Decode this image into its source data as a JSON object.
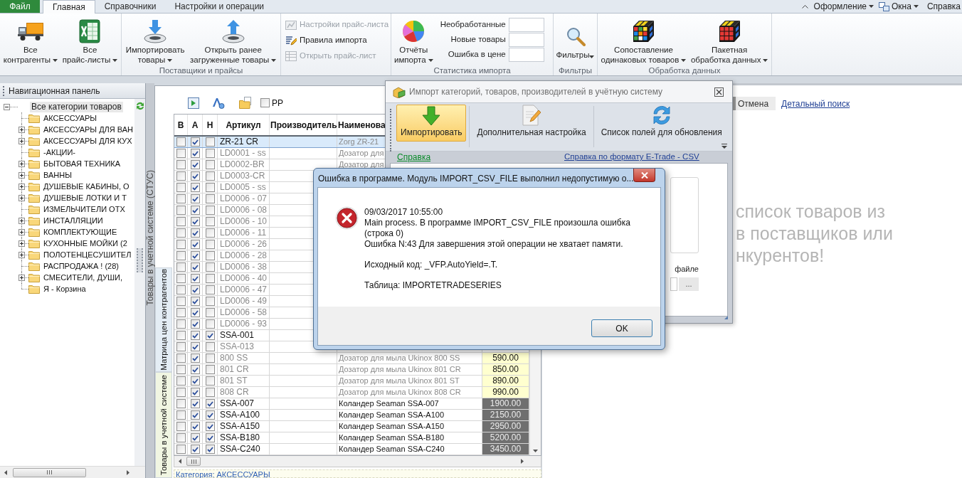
{
  "menu_bar": {
    "file_button": "Файл",
    "tabs": [
      {
        "label": "Главная",
        "selected": true
      },
      {
        "label": "Справочники",
        "selected": false
      },
      {
        "label": "Настройки и операции",
        "selected": false
      }
    ],
    "right_items": [
      {
        "label": "Оформление",
        "kind": "dropdown"
      },
      {
        "label": "Окна",
        "kind": "windows"
      },
      {
        "label": "Справка",
        "kind": "plain"
      }
    ]
  },
  "ribbon": {
    "groups": [
      {
        "kind": "large",
        "buttons": [
          {
            "label": "Все\nконтрагенты",
            "dropdown": true
          },
          {
            "label": "Все\nпрайс-листы",
            "dropdown": true
          }
        ]
      },
      {
        "kind": "large",
        "title": "Поставщики и прайсы",
        "buttons": [
          {
            "label": "Импортировать\nтовары",
            "dropdown": true
          },
          {
            "label": "Открыть ранее\nзагруженные товары",
            "dropdown": true
          }
        ]
      },
      {
        "kind": "small",
        "items": [
          {
            "label": "Настройки прайс-листа",
            "disabled": true
          },
          {
            "label": "Правила импорта",
            "disabled": false
          },
          {
            "label": "Открыть прайс-лист",
            "disabled": true
          }
        ]
      },
      {
        "kind": "stats",
        "title": "Статистика импорта",
        "buttons": [
          {
            "label": "Отчёты\nимпорта",
            "dropdown": true
          }
        ],
        "counters": [
          "Необработанные",
          "Новые товары",
          "Ошибка в цене"
        ]
      },
      {
        "kind": "single",
        "title": "Фильтры",
        "buttons": [
          {
            "label": "Фильтры",
            "dropdown": true
          }
        ]
      },
      {
        "kind": "large",
        "title": "Обработка данных",
        "buttons": [
          {
            "label": "Сопоставление\nодинаковых товаров",
            "dropdown": true
          },
          {
            "label": "Пакетная\nобработка данных",
            "dropdown": true
          }
        ]
      }
    ]
  },
  "nav_panel": {
    "title": "Навигационная панель",
    "tree": [
      {
        "label": "Все категории товаров",
        "expanded": true,
        "selected": true,
        "children": [
          {
            "label": "АКСЕССУАРЫ",
            "expandable": false,
            "selected": false
          },
          {
            "label": "АКСЕССУАРЫ ДЛЯ ВАН",
            "expandable": true,
            "selected": false
          },
          {
            "label": "АКСЕССУАРЫ ДЛЯ КУХ",
            "expandable": true,
            "selected": false
          },
          {
            "label": "-АКЦИИ-",
            "expandable": false,
            "selected": false
          },
          {
            "label": "БЫТОВАЯ ТЕХНИКА",
            "expandable": true,
            "selected": false
          },
          {
            "label": "ВАННЫ",
            "expandable": true,
            "selected": false
          },
          {
            "label": "ДУШЕВЫЕ КАБИНЫ, О",
            "expandable": true,
            "selected": false
          },
          {
            "label": "ДУШЕВЫЕ ЛОТКИ И Т",
            "expandable": true,
            "selected": false
          },
          {
            "label": "ИЗМЕЛЬЧИТЕЛИ ОТХ",
            "expandable": false,
            "selected": false
          },
          {
            "label": "ИНСТАЛЛЯЦИИ",
            "expandable": true,
            "selected": false
          },
          {
            "label": "КОМПЛЕКТУЮЩИЕ",
            "expandable": true,
            "selected": false
          },
          {
            "label": "КУХОННЫЕ МОЙКИ (2",
            "expandable": true,
            "selected": false
          },
          {
            "label": "ПОЛОТЕНЦЕСУШИТЕЛ",
            "expandable": true,
            "selected": false
          },
          {
            "label": "РАСПРОДАЖА ! (28)",
            "expandable": false,
            "selected": false
          },
          {
            "label": "СМЕСИТЕЛИ, ДУШИ,",
            "expandable": true,
            "selected": false
          },
          {
            "label": "Я - Корзина",
            "expandable": false,
            "selected": false
          }
        ]
      }
    ]
  },
  "docked_panel": {
    "title": "Товары в учетной системе (СТУС)"
  },
  "view_tabs": [
    {
      "label": "Матрица цен контрагентов",
      "color": "#e4edf5"
    },
    {
      "label": "Товары в учетной системе",
      "color": "#f1f6e2"
    }
  ],
  "table_toolbar": {
    "pp_checkbox": {
      "label": "PP",
      "checked": false
    }
  },
  "table": {
    "columns": [
      "В",
      "А",
      "Н",
      "Артикул",
      "Производитель",
      "Наименова"
    ],
    "rows": [
      {
        "check_v": false,
        "check_a": true,
        "check_n": false,
        "article": "ZR-21 CR",
        "name": "Zorg ZR-21",
        "greyed": true,
        "selected": true
      },
      {
        "check_v": false,
        "check_a": true,
        "check_n": false,
        "article": "LD0001 - ss",
        "name": "Дозатор для",
        "greyed": true,
        "selected": false
      },
      {
        "check_v": false,
        "check_a": true,
        "check_n": false,
        "article": "LD0002-BR",
        "name": "Дозатор для",
        "greyed": true,
        "selected": false
      },
      {
        "check_v": false,
        "check_a": true,
        "check_n": false,
        "article": "LD0003-CR",
        "greyed": true,
        "selected": false
      },
      {
        "check_v": false,
        "check_a": true,
        "check_n": false,
        "article": "LD0005 - ss",
        "greyed": true,
        "selected": false
      },
      {
        "check_v": false,
        "check_a": true,
        "check_n": false,
        "article": "LD0006 - 07",
        "greyed": true,
        "selected": false
      },
      {
        "check_v": false,
        "check_a": true,
        "check_n": false,
        "article": "LD0006 - 08",
        "greyed": true,
        "selected": false
      },
      {
        "check_v": false,
        "check_a": true,
        "check_n": false,
        "article": "LD0006 - 10",
        "greyed": true,
        "selected": false
      },
      {
        "check_v": false,
        "check_a": true,
        "check_n": false,
        "article": "LD0006 - 11",
        "greyed": true,
        "selected": false
      },
      {
        "check_v": false,
        "check_a": true,
        "check_n": false,
        "article": "LD0006 - 26",
        "greyed": true,
        "selected": false
      },
      {
        "check_v": false,
        "check_a": true,
        "check_n": false,
        "article": "LD0006 - 28",
        "greyed": true,
        "selected": false
      },
      {
        "check_v": false,
        "check_a": true,
        "check_n": false,
        "article": "LD0006 - 38",
        "greyed": true,
        "selected": false
      },
      {
        "check_v": false,
        "check_a": true,
        "check_n": false,
        "article": "LD0006 - 40",
        "greyed": true,
        "selected": false
      },
      {
        "check_v": false,
        "check_a": true,
        "check_n": false,
        "article": "LD0006 - 47",
        "greyed": true,
        "selected": false
      },
      {
        "check_v": false,
        "check_a": true,
        "check_n": false,
        "article": "LD0006 - 49",
        "greyed": true,
        "selected": false
      },
      {
        "check_v": false,
        "check_a": true,
        "check_n": false,
        "article": "LD0006 - 58",
        "greyed": true,
        "selected": false
      },
      {
        "check_v": false,
        "check_a": true,
        "check_n": false,
        "article": "LD0006 - 93",
        "greyed": true,
        "selected": false
      },
      {
        "check_v": false,
        "check_a": true,
        "check_n": true,
        "article": "SSA-001",
        "greyed": false,
        "selected": false
      },
      {
        "check_v": false,
        "check_a": true,
        "check_n": false,
        "article": "SSA-013",
        "greyed": true,
        "selected": false
      },
      {
        "check_v": false,
        "check_a": true,
        "check_n": false,
        "article": "800 SS",
        "name": "Дозатор для мыла Ukinox 800 SS",
        "price": {
          "text": "590.00",
          "color": "#ffffcf"
        },
        "greyed": true,
        "selected": false
      },
      {
        "check_v": false,
        "check_a": true,
        "check_n": false,
        "article": "801 CR",
        "name": "Дозатор для мыла Ukinox 801 CR",
        "price": {
          "text": "850.00",
          "color": "#ffffcf"
        },
        "greyed": true,
        "selected": false
      },
      {
        "check_v": false,
        "check_a": true,
        "check_n": false,
        "article": "801 ST",
        "name": "Дозатор для мыла Ukinox 801 ST",
        "price": {
          "text": "890.00",
          "color": "#ffffcf"
        },
        "greyed": true,
        "selected": false
      },
      {
        "check_v": false,
        "check_a": true,
        "check_n": false,
        "article": "808 CR",
        "name": "Дозатор для мыла Ukinox 808 CR",
        "price": {
          "text": "990.00",
          "color": "#ffffcf"
        },
        "greyed": true,
        "selected": false
      },
      {
        "check_v": false,
        "check_a": true,
        "check_n": true,
        "article": "SSA-007",
        "name": "Коландер Seaman SSA-007",
        "price": {
          "text": "1900.00",
          "color": "#6f6f6f"
        },
        "greyed": false,
        "selected": false
      },
      {
        "check_v": false,
        "check_a": true,
        "check_n": true,
        "article": "SSA-A100",
        "name": "Коландер Seaman SSA-A100",
        "price": {
          "text": "2150.00",
          "color": "#6f6f6f"
        },
        "greyed": false,
        "selected": false
      },
      {
        "check_v": false,
        "check_a": true,
        "check_n": true,
        "article": "SSA-A150",
        "name": "Коландер Seaman SSA-A150",
        "price": {
          "text": "2950.00",
          "color": "#6f6f6f"
        },
        "greyed": false,
        "selected": false
      },
      {
        "check_v": false,
        "check_a": true,
        "check_n": true,
        "article": "SSA-B180",
        "name": "Коландер Seaman SSA-B180",
        "price": {
          "text": "5200.00",
          "color": "#6f6f6f"
        },
        "greyed": false,
        "selected": false
      },
      {
        "check_v": false,
        "check_a": true,
        "check_n": true,
        "article": "SSA-C240",
        "name": "Коландер Seaman SSA-C240",
        "price": {
          "text": "3450.00",
          "color": "#6f6f6f"
        },
        "greyed": false,
        "selected": false
      }
    ],
    "category": "Категория: АКСЕССУАРЫ"
  },
  "right_panel": {
    "cancel_button": "Отмена",
    "detail_search_link": "Детальный поиск",
    "hint_lines": [
      "список товаров из",
      "в поставщиков или",
      "нкурентов!"
    ]
  },
  "import_dialog": {
    "title": "Импорт категорий, товаров, производителей в учётную систему",
    "toolbar": [
      {
        "label": "Импортировать",
        "highlighted": true
      },
      {
        "label": "Дополнительная настройка",
        "highlighted": false
      },
      {
        "label": "Список полей для обновления",
        "highlighted": false
      }
    ],
    "help_link": "Справка",
    "format_help_link": "Справка по формату E-Trade - CSV",
    "file_label": "файле",
    "browse_button": "..."
  },
  "error_dialog": {
    "title": "Ошибка в программе. Модуль IMPORT_CSV_FILE выполнил недопустимую о...",
    "message_blocks": [
      [
        "09/03/2017 10:55:00",
        "Main process. В программе IMPORT_CSV_FILE произошла ошибка (строка 0)",
        "Ошибка N:43 Для завершения этой операции не хватает памяти."
      ],
      [
        "Исходный код: _VFP.AutoYield=.T."
      ],
      [
        "Таблица: IMPORTETRADESERIES"
      ]
    ],
    "ok_button": "OK"
  }
}
